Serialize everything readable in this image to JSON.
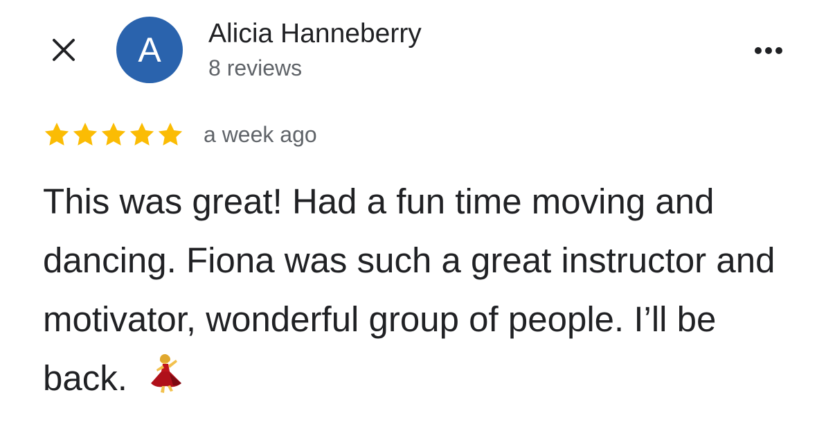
{
  "reviewer": {
    "avatar_initial": "A",
    "avatar_color": "#2a63ad",
    "name": "Alicia Hanneberry",
    "review_count": "8 reviews"
  },
  "review": {
    "rating": 5,
    "rating_max": 5,
    "star_color": "#fbbc04",
    "time": "a week ago",
    "text": "This was great! Had a fun time moving and dancing. Fiona was such a great instructor and motivator, wonderful group of people. I’ll be back.",
    "emoji": "dancer-emoji"
  },
  "icons": {
    "close": "close-icon",
    "more": "more-options-icon"
  }
}
